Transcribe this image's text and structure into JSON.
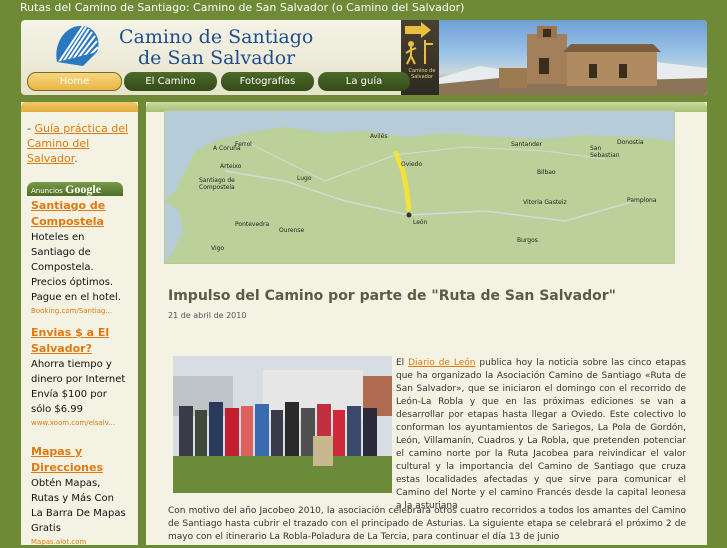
{
  "page": {
    "title": "Rutas del Camino de Santiago: Camino de San Salvador (o Camino del Salvador)"
  },
  "header": {
    "logo_line1": "Camino de Santiago",
    "logo_line2": "de San Salvador",
    "sign_text": "Camino de Salvador"
  },
  "nav": {
    "items": [
      "Home",
      "El Camino",
      "Fotografías",
      "La guía"
    ],
    "active": "Home"
  },
  "sidebar": {
    "link_prefix": "- ",
    "link_text": "Guía práctica del Camino del Salvador",
    "link_suffix": ".",
    "ads_header_small": "Anuncios",
    "ads_header_brand": "Google",
    "ads": [
      {
        "title": "Santiago de Compostela",
        "body": "Hoteles en Santiago de Compostela. Precios óptimos. Pague en el hotel.",
        "url": "Booking.com/Santiag..."
      },
      {
        "title": "Envias $ a El Salvador?",
        "body": "Ahorra tiempo y dinero por Internet Envía $100 por sólo $6.99",
        "url": "www.xoom.com/elsalv..."
      },
      {
        "title": "Mapas y Direcciones",
        "body": "Obtén Mapas, Rutas y Más Con La Barra De Mapas Gratis",
        "url": "Mapas.alot.com"
      }
    ]
  },
  "map": {
    "labels": [
      "A Coruña",
      "Ferrol",
      "Arteixo",
      "Lugo",
      "Avilés",
      "Oviedo",
      "Santander",
      "Bilbao",
      "San Sebastian",
      "Donostia",
      "Vitoria Gasteiz",
      "Pamplona",
      "Burgos",
      "León",
      "Santiago de Compostela",
      "Ourense",
      "Pontevedra",
      "Vigo"
    ]
  },
  "post": {
    "title": "Impulso del Camino por parte de \"Ruta de San Salvador\"",
    "date": "21 de abril de 2010",
    "p1_before": "El ",
    "p1_link": "Diario de León",
    "p1_after": " publica hoy la noticia sobre las cinco etapas que ha organizado la Asociación Camino de Santiago «Ruta de San Salvador», que se iniciaron el domingo con el recorrido de León-La Robla y que en las próximas ediciones se van a desarrollar por etapas hasta llegar a Oviedo. Este colectivo lo conforman los ayuntamientos de Sariegos, La Pola de Gordón, León, Villamanín, Cuadros y La Robla, que pretenden potenciar el camino norte por la Ruta Jacobea para reivindicar el valor cultural y la importancia del Camino de Santiago que cruza estas localidades afectadas y que sirve para comunicar el Camino del Norte y el camino Francés desde la capital leonesa a la asturiana",
    "p2": "Con motivo del año Jacobeo 2010, la asociación celebrará otros cuatro recorridos a todos los amantes del Camino de Santiago hasta cubrir el trazado con el principado de Asturias. La siguiente etapa se celebrará el próximo 2 de mayo con el itinerario La Robla-Poladura de La Tercia, para continuar el día 13 de junio"
  },
  "colors": {
    "background": "#6f8a36",
    "accent": "#e07a10",
    "title_blue": "#1f4c8c"
  }
}
